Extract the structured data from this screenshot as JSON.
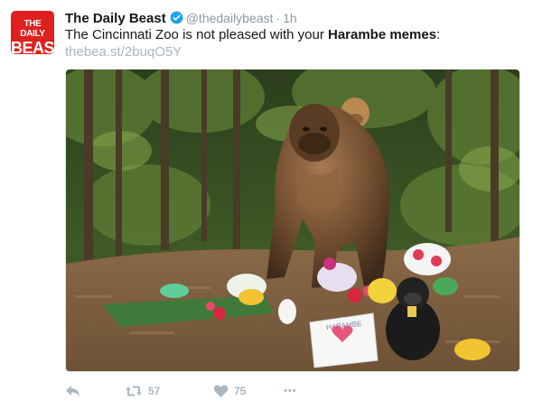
{
  "tweet": {
    "author_name": "The Daily Beast",
    "handle": "@thedailybeast",
    "separator": "·",
    "time": "1h",
    "avatar_line1": "THE DAILY",
    "avatar_line2": "BEAST",
    "text_before": "The Cincinnati Zoo is not pleased with your ",
    "text_bold": "Harambe memes",
    "text_after": ":",
    "link": "thebea.st/2buqO5Y",
    "retweet_count": "57",
    "like_count": "75",
    "more_label": "•••",
    "sign_text": "HARAMBE"
  },
  "colors": {
    "brand_red": "#e0201f",
    "verified_blue": "#1da1f2",
    "muted": "#8899a6",
    "action_gray": "#aab8c2"
  },
  "icons": [
    "verified-badge-icon",
    "reply-icon",
    "retweet-icon",
    "like-icon",
    "more-icon"
  ]
}
